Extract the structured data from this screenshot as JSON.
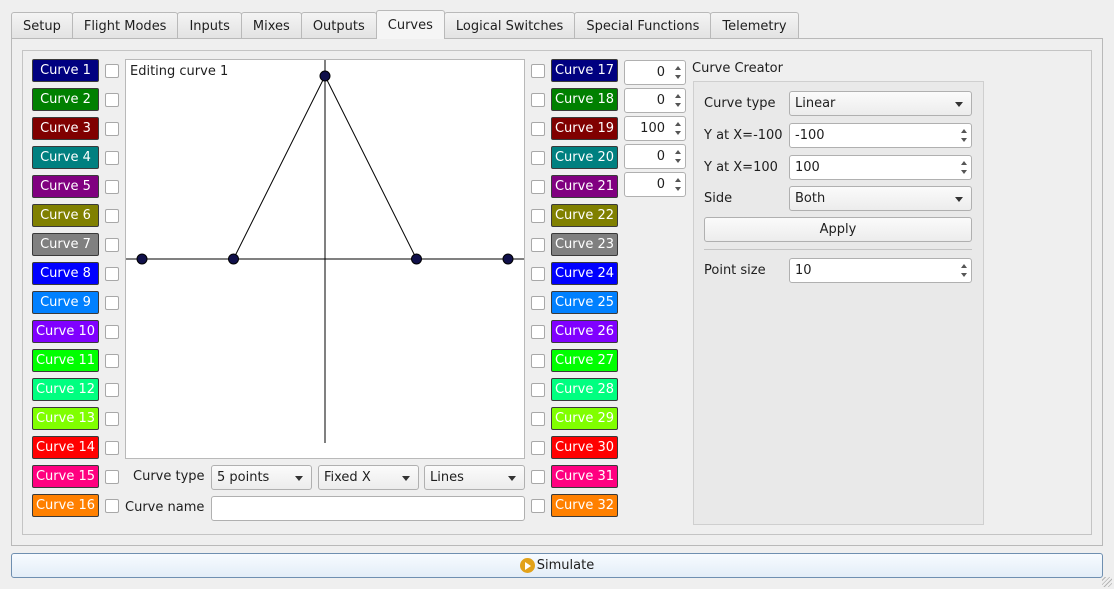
{
  "tabs": [
    "Setup",
    "Flight Modes",
    "Inputs",
    "Mixes",
    "Outputs",
    "Curves",
    "Logical Switches",
    "Special Functions",
    "Telemetry"
  ],
  "active_tab": "Curves",
  "curves": [
    {
      "label": "Curve 1",
      "color": "#000080"
    },
    {
      "label": "Curve 2",
      "color": "#008000"
    },
    {
      "label": "Curve 3",
      "color": "#800000"
    },
    {
      "label": "Curve 4",
      "color": "#008080"
    },
    {
      "label": "Curve 5",
      "color": "#800080"
    },
    {
      "label": "Curve 6",
      "color": "#808000"
    },
    {
      "label": "Curve 7",
      "color": "#808080"
    },
    {
      "label": "Curve 8",
      "color": "#0000ff"
    },
    {
      "label": "Curve 9",
      "color": "#0080ff"
    },
    {
      "label": "Curve 10",
      "color": "#8000ff"
    },
    {
      "label": "Curve 11",
      "color": "#00ff00"
    },
    {
      "label": "Curve 12",
      "color": "#00ff80"
    },
    {
      "label": "Curve 13",
      "color": "#80ff00"
    },
    {
      "label": "Curve 14",
      "color": "#ff0000"
    },
    {
      "label": "Curve 15",
      "color": "#ff0080"
    },
    {
      "label": "Curve 16",
      "color": "#ff8000"
    },
    {
      "label": "Curve 17",
      "color": "#000080"
    },
    {
      "label": "Curve 18",
      "color": "#008000"
    },
    {
      "label": "Curve 19",
      "color": "#800000"
    },
    {
      "label": "Curve 20",
      "color": "#008080"
    },
    {
      "label": "Curve 21",
      "color": "#800080"
    },
    {
      "label": "Curve 22",
      "color": "#808000"
    },
    {
      "label": "Curve 23",
      "color": "#808080"
    },
    {
      "label": "Curve 24",
      "color": "#0000ff"
    },
    {
      "label": "Curve 25",
      "color": "#0080ff"
    },
    {
      "label": "Curve 26",
      "color": "#8000ff"
    },
    {
      "label": "Curve 27",
      "color": "#00ff00"
    },
    {
      "label": "Curve 28",
      "color": "#00ff80"
    },
    {
      "label": "Curve 29",
      "color": "#80ff00"
    },
    {
      "label": "Curve 30",
      "color": "#ff0000"
    },
    {
      "label": "Curve 31",
      "color": "#ff0080"
    },
    {
      "label": "Curve 32",
      "color": "#ff8000"
    }
  ],
  "editor": {
    "title": "Editing curve 1",
    "points_x": [
      -100,
      -50,
      0,
      50,
      100
    ],
    "points_y": [
      0,
      0,
      100,
      0,
      0
    ],
    "point_color": "#10104a",
    "y_values": [
      "0",
      "0",
      "100",
      "0",
      "0"
    ],
    "curve_type_label": "Curve type",
    "curve_type_value": "5 points",
    "x_mode_value": "Fixed X",
    "draw_mode_value": "Lines",
    "curve_name_label": "Curve name",
    "curve_name_value": ""
  },
  "creator": {
    "title": "Curve Creator",
    "curve_type_label": "Curve type",
    "curve_type_value": "Linear",
    "y_min_label": "Y at X=-100",
    "y_min_value": "-100",
    "y_max_label": "Y at X=100",
    "y_max_value": "100",
    "side_label": "Side",
    "side_value": "Both",
    "apply_label": "Apply",
    "point_size_label": "Point size",
    "point_size_value": "10"
  },
  "simulate_label": "Simulate"
}
